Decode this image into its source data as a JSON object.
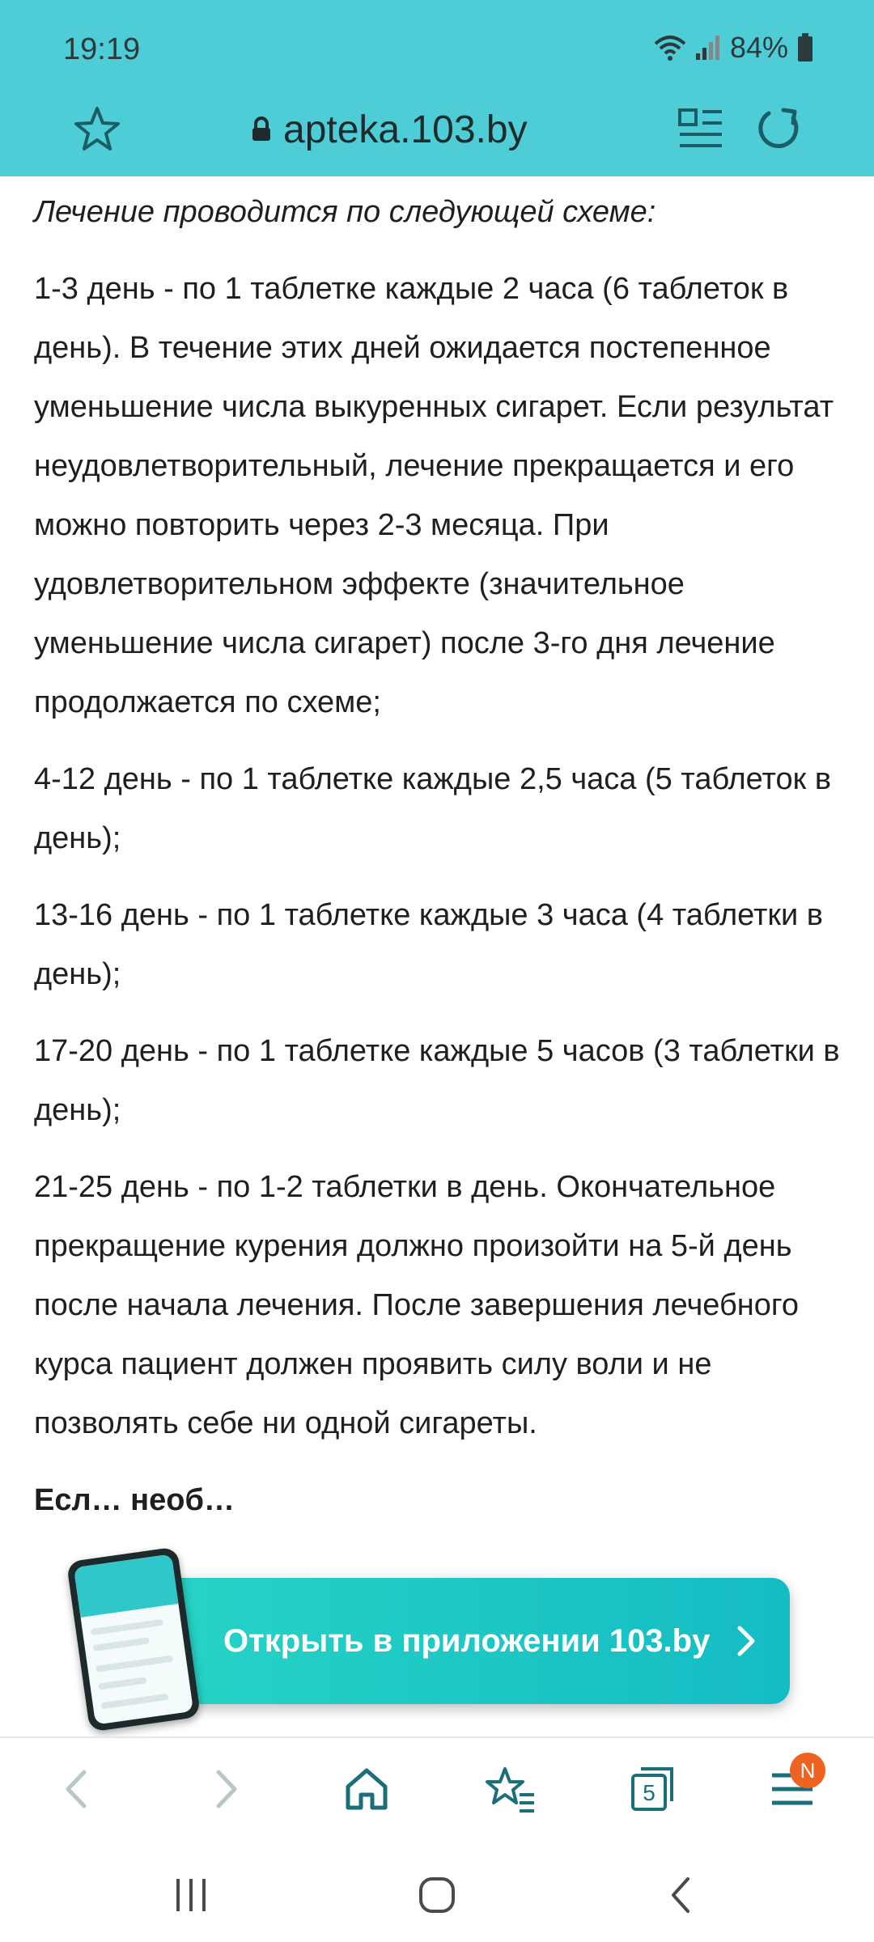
{
  "status_bar": {
    "time": "19:19",
    "battery": "84%",
    "icons": [
      "wifi-icon",
      "signal-icon",
      "battery-icon"
    ]
  },
  "browser": {
    "url": "apteka.103.by",
    "icons": [
      "star-icon",
      "lock-icon",
      "reader-icon",
      "reload-icon"
    ]
  },
  "article": {
    "intro": "Лечение проводится по следующей схеме:",
    "paragraphs": [
      "1-3 день - по 1 таблетке каждые 2 часа (6 таблеток в день). В течение этих дней ожидается постепенное уменьшение числа выкуренных сигарет. Если результат неудовлетворительный, лечение прекращается и его можно повторить через 2-3 месяца. При удовлетворительном эффекте (значительное уменьшение числа сигарет) после 3-го дня лечение продолжается по схеме;",
      "4-12 день - по 1 таблетке каждые 2,5 часа (5 таблеток в день);",
      "13-16 день - по 1 таблетке каждые 3 часа (4 таблетки в день);",
      "17-20 день - по 1 таблетке каждые 5 часов (3 таблетки в день);",
      "21-25 день - по 1-2 таблетки в день. Окончательное прекращение курения должно произойти на 5-й день после начала лечения. После завершения лечебного курса пациент должен проявить силу воли и не позволять себе ни одной сигареты."
    ],
    "partial_bold": "Есл… необ…"
  },
  "app_banner": {
    "label": "Открыть в приложении 103.by",
    "arrow_icon": "chevron-right-icon"
  },
  "toolbar": {
    "buttons": [
      "back-icon",
      "forward-icon",
      "home-icon",
      "bookmarks-icon",
      "tabs-icon",
      "menu-icon"
    ],
    "tabs_count": "5",
    "menu_badge": "N"
  },
  "system_nav": {
    "buttons": [
      "recents-icon",
      "home-circle-icon",
      "back-system-icon"
    ]
  },
  "colors": {
    "topbar": "#4ecdd6",
    "banner": "#1fc6c4",
    "badge": "#f0621f",
    "icon_teal": "#1b6f78"
  }
}
